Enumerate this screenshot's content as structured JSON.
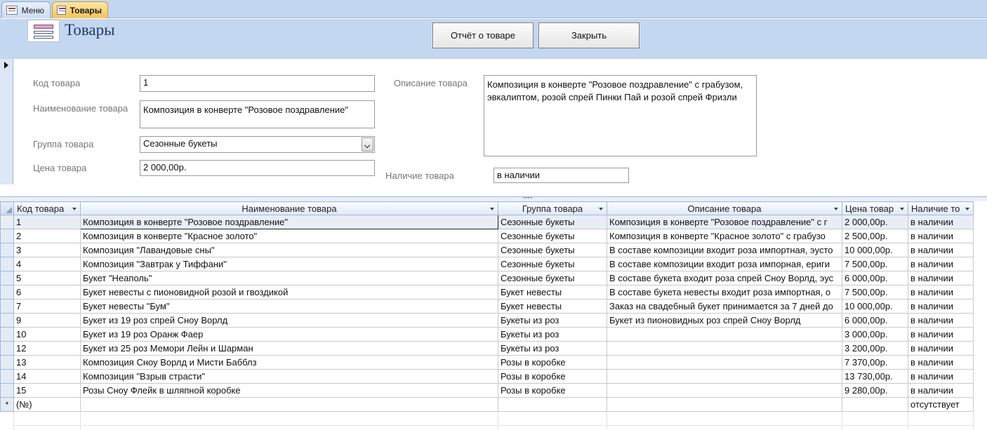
{
  "tabs": [
    {
      "label": "Меню",
      "icon": "form-icon"
    },
    {
      "label": "Товары",
      "icon": "form-icon",
      "active": true
    }
  ],
  "header": {
    "title": "Товары",
    "report_button": "Отчёт о товаре",
    "close_button": "Закрыть"
  },
  "form": {
    "code_label": "Код товара",
    "code_value": "1",
    "name_label": "Наименование товара",
    "name_value": "Композиция в конверте \"Розовое поздравление\"",
    "group_label": "Группа товара",
    "group_value": "Сезонные букеты",
    "price_label": "Цена товара",
    "price_value": "2 000,00р.",
    "desc_label": "Описание товара",
    "desc_value": "Композиция в конверте \"Розовое поздравление\" с грабузом, эвкалиптом, розой спрей Пинки Пай и розой спрей Фризли",
    "avail_label": "Наличие товара",
    "avail_value": "в наличии"
  },
  "splitter_grip": "''''''''''",
  "table": {
    "columns": [
      "Код товара",
      "Наименование товара",
      "Группа товара",
      "Описание товара",
      "Цена товар",
      "Наличие то"
    ],
    "rows": [
      {
        "code": "1",
        "name": "Композиция в конверте \"Розовое поздравление\"",
        "group": "Сезонные букеты",
        "desc": "Композиция в конверте \"Розовое поздравление\" с г",
        "price": "2 000,00р.",
        "avail": "в наличии"
      },
      {
        "code": "2",
        "name": "Композиция в конверте \"Красное золото\"",
        "group": "Сезонные букеты",
        "desc": "Композиция в конверте \"Красное золото\" с грабузо",
        "price": "2 500,00р.",
        "avail": "в наличии"
      },
      {
        "code": "3",
        "name": "Композиция \"Лавандовые сны\"",
        "group": "Сезонные букеты",
        "desc": "В составе композиции входит роза импортная, эусто",
        "price": "10 000,00р.",
        "avail": "в наличии"
      },
      {
        "code": "4",
        "name": "Композиция \"Завтрак у Тиффани\"",
        "group": "Сезонные букеты",
        "desc": "В составе композиции входит роза импорная, ериги",
        "price": "7 500,00р.",
        "avail": "в наличии"
      },
      {
        "code": "5",
        "name": "Букет \"Неаполь\"",
        "group": "Сезонные букеты",
        "desc": "В составе букета входит роза спрей Сноу Ворлд, эус",
        "price": "6 000,00р.",
        "avail": "в наличии"
      },
      {
        "code": "6",
        "name": "Букет невесты с пионовидной розой и гвоздикой",
        "group": "Букет невесты",
        "desc": "В составе букета невесты входит роза импортная, о",
        "price": "7 500,00р.",
        "avail": "в наличии"
      },
      {
        "code": "7",
        "name": "Букет невесты \"Бум\"",
        "group": "Букет невесты",
        "desc": "Заказ на свадебный букет принимается за 7 дней до",
        "price": "10 000,00р.",
        "avail": "в наличии"
      },
      {
        "code": "9",
        "name": "Букет из 19 роз спрей Сноу Ворлд",
        "group": "Букеты из роз",
        "desc": "Букет из пионовидных роз спрей Сноу Ворлд",
        "price": "6 000,00р.",
        "avail": "в наличии"
      },
      {
        "code": "10",
        "name": "Букет из 19 роз Оранж Фаер",
        "group": "Букеты из роз",
        "desc": "",
        "price": "3 000,00р.",
        "avail": "в наличии"
      },
      {
        "code": "12",
        "name": "Букет из 25 роз Мемори Лейн и Шарман",
        "group": "Букеты из роз",
        "desc": "",
        "price": "3 200,00р.",
        "avail": "в наличии"
      },
      {
        "code": "13",
        "name": "Композиция Сноу Ворлд и Мисти Бабблз",
        "group": "Розы в коробке",
        "desc": "",
        "price": "7 370,00р.",
        "avail": "в наличии"
      },
      {
        "code": "14",
        "name": "Композиция \"Взрыв страсти\"",
        "group": "Розы в коробке",
        "desc": "",
        "price": "13 730,00р.",
        "avail": "в наличии"
      },
      {
        "code": "15",
        "name": "Розы Сноу Флейк в шляпной коробке",
        "group": "Розы в коробке",
        "desc": "",
        "price": "9 280,00р.",
        "avail": "в наличии"
      }
    ],
    "new_row": {
      "marker": "*",
      "code": "(№)",
      "avail": "отсутствует"
    }
  }
}
